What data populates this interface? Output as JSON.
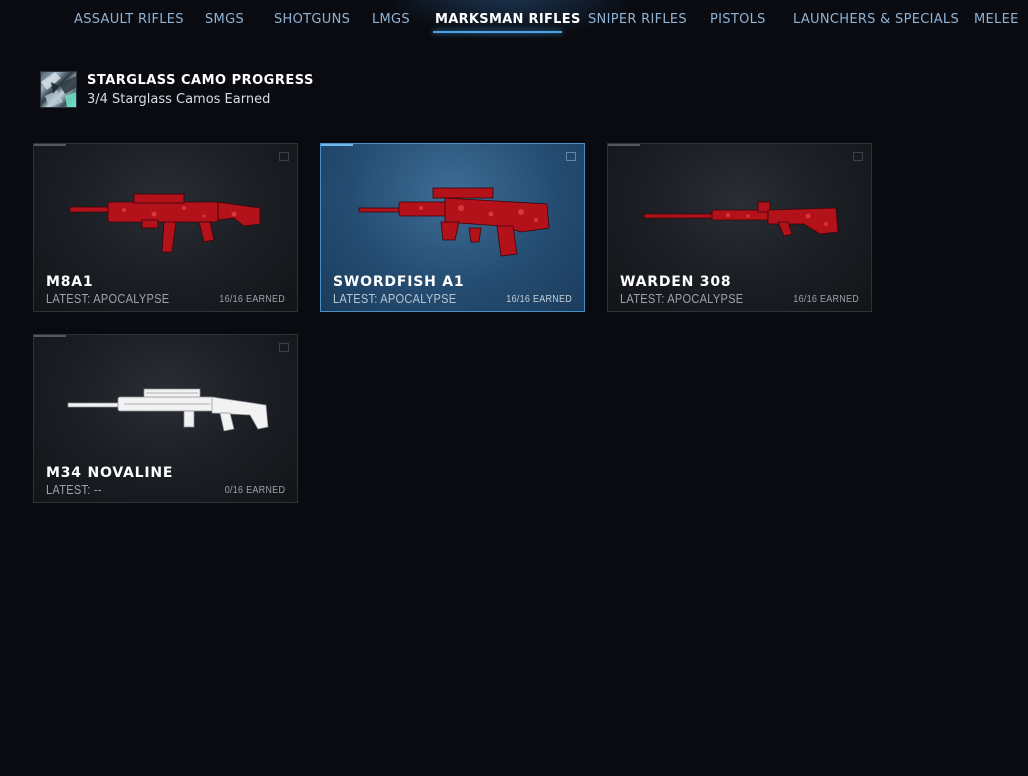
{
  "tabs": [
    {
      "label": "ASSAULT RIFLES",
      "active": false
    },
    {
      "label": "SMGS",
      "active": false
    },
    {
      "label": "SHOTGUNS",
      "active": false
    },
    {
      "label": "LMGS",
      "active": false
    },
    {
      "label": "MARKSMAN RIFLES",
      "active": true
    },
    {
      "label": "SNIPER RIFLES",
      "active": false
    },
    {
      "label": "PISTOLS",
      "active": false
    },
    {
      "label": "LAUNCHERS & SPECIALS",
      "active": false
    },
    {
      "label": "MELEE",
      "active": false
    }
  ],
  "progress": {
    "title": "STARGLASS CAMO PROGRESS",
    "subtitle": "3/4 Starglass Camos Earned",
    "icon": "starglass-camo-icon"
  },
  "cards": [
    {
      "name": "M8A1",
      "latest": "LATEST: APOCALYPSE",
      "earned": "16/16 EARNED",
      "selected": false,
      "camo": "red"
    },
    {
      "name": "SWORDFISH A1",
      "latest": "LATEST: APOCALYPSE",
      "earned": "16/16 EARNED",
      "selected": true,
      "camo": "red"
    },
    {
      "name": "WARDEN 308",
      "latest": "LATEST: APOCALYPSE",
      "earned": "16/16 EARNED",
      "selected": false,
      "camo": "red"
    },
    {
      "name": "M34 NOVALINE",
      "latest": "LATEST: --",
      "earned": "0/16 EARNED",
      "selected": false,
      "camo": "white"
    }
  ],
  "colors": {
    "accent": "#4aa3e6",
    "tab_inactive": "#8fb3d6",
    "camo_red": "#b3121b",
    "camo_white": "#f2f2f2"
  }
}
